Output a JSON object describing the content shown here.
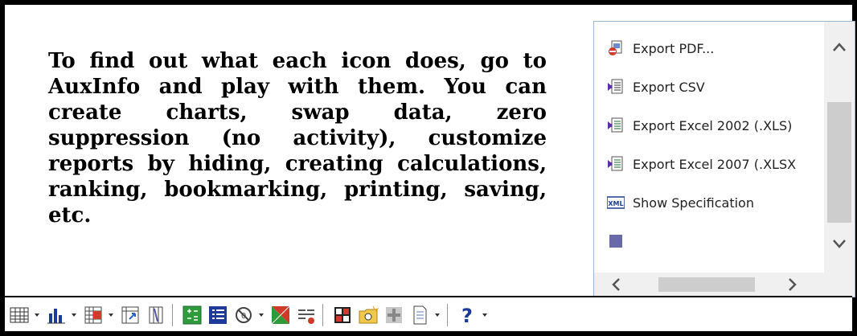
{
  "description": "To find out what each icon does, go to AuxInfo and play with them.  You can create charts, swap data, zero suppression (no activity), customize reports by hiding, creating calculations, ranking, bookmarking, printing, saving, etc.",
  "export_menu": {
    "items": [
      {
        "label": "Export PDF...",
        "icon": "pdf-export-icon"
      },
      {
        "label": "Export CSV",
        "icon": "csv-export-icon"
      },
      {
        "label": "Export Excel 2002 (.XLS)",
        "icon": "excel-2002-icon"
      },
      {
        "label": "Export Excel 2007 (.XLSX",
        "icon": "excel-2007-icon"
      },
      {
        "label": "Show Specification",
        "icon": "xml-icon"
      }
    ],
    "xml_icon_text": "XML"
  },
  "toolbar": {
    "buttons": [
      "grid-view-icon",
      "bar-chart-icon",
      "swap-data-icon",
      "pivot-icon",
      "column-icon",
      "calculation-icon",
      "list-icon",
      "zero-suppression-icon",
      "ranking-icon",
      "filter-icon",
      "layout-icon",
      "bookmark-icon",
      "hide-icon",
      "page-icon",
      "help-icon"
    ],
    "help_glyph": "?"
  }
}
